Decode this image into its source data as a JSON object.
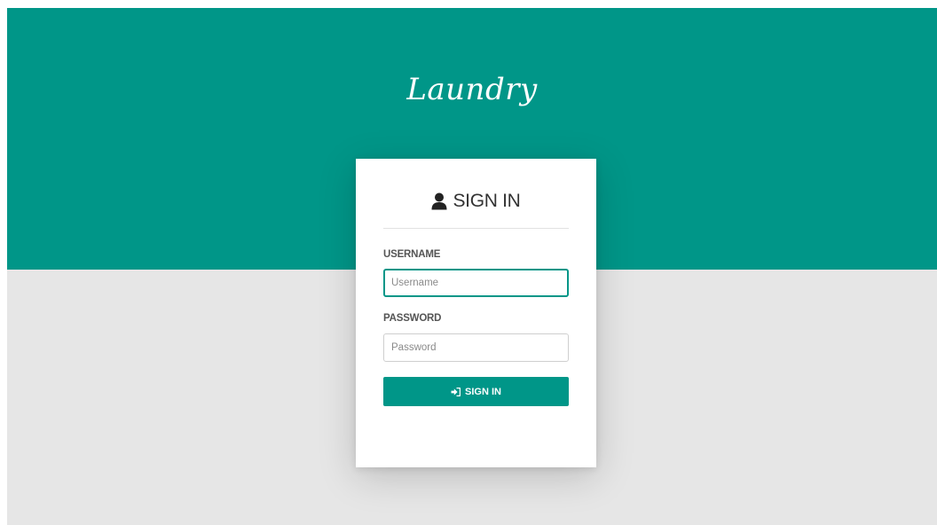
{
  "brand": {
    "title": "Laundry"
  },
  "login": {
    "title": "SIGN IN",
    "username_label": "USERNAME",
    "username_placeholder": "Username",
    "username_value": "",
    "password_label": "PASSWORD",
    "password_placeholder": "Password",
    "password_value": "",
    "submit_label": "SIGN IN"
  },
  "icons": {
    "header": "user-icon",
    "submit": "sign-in-icon"
  },
  "colors": {
    "accent": "#009688",
    "background": "#e6e6e6",
    "card": "#ffffff"
  }
}
